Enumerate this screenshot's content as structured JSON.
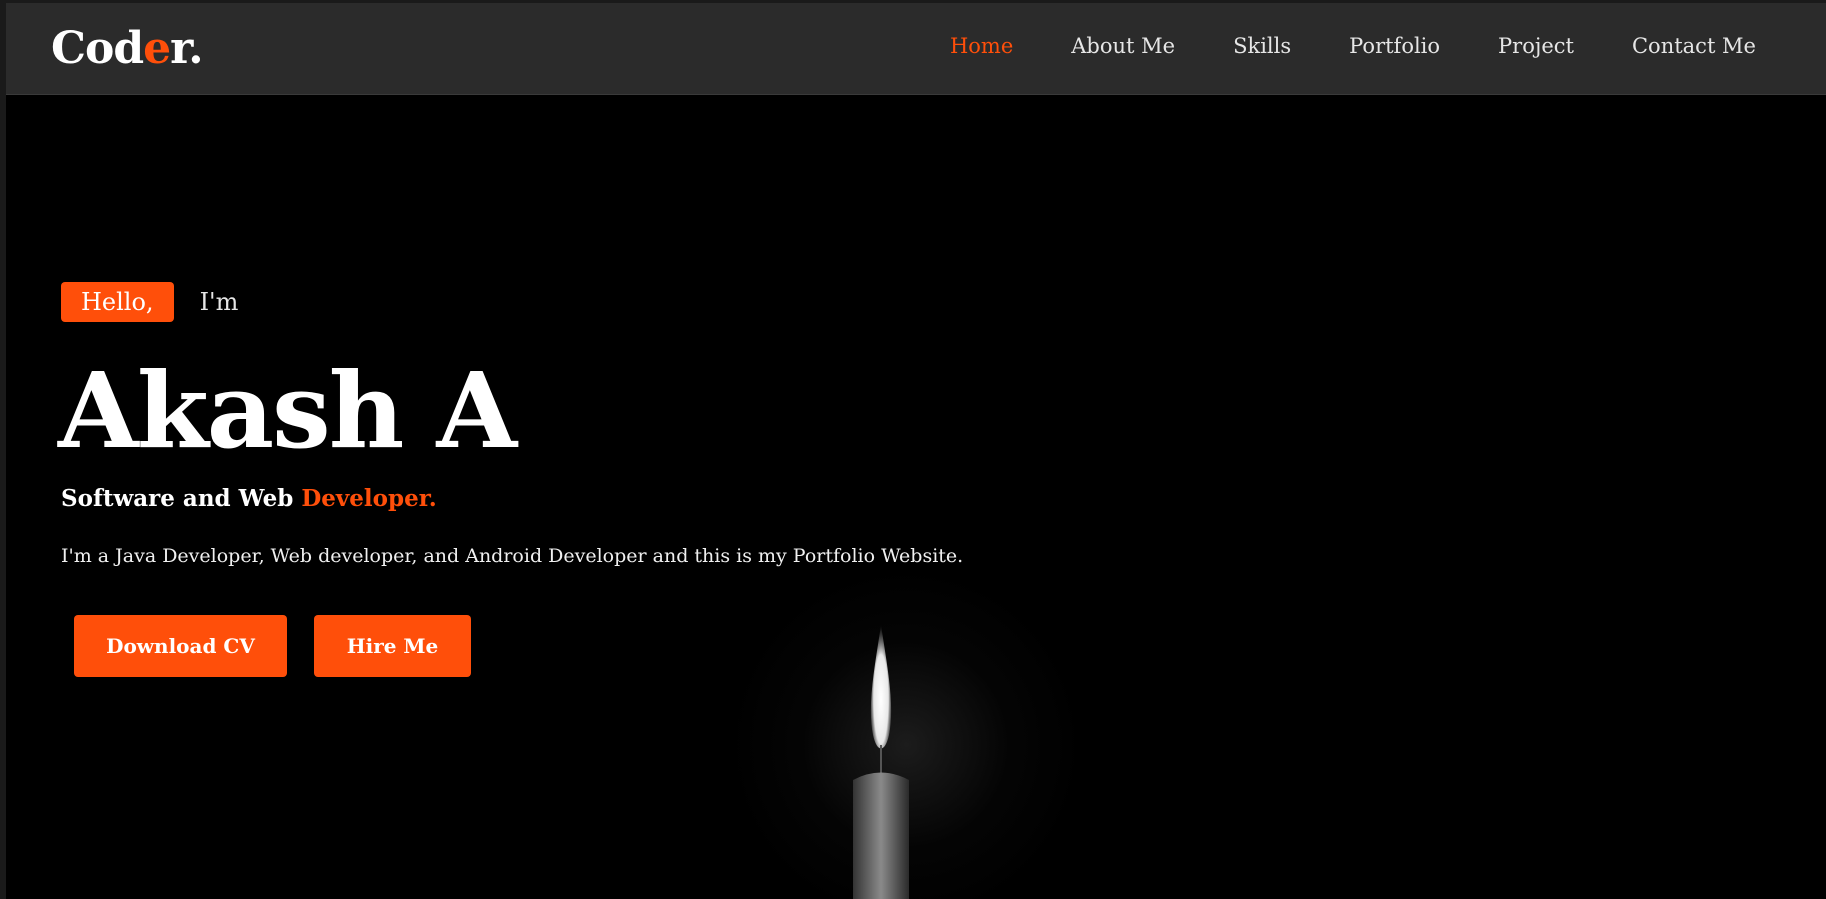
{
  "logo": {
    "text_main": "Cod",
    "text_accent": "e",
    "text_end": "r."
  },
  "nav": {
    "items": [
      {
        "label": "Home",
        "active": true
      },
      {
        "label": "About Me"
      },
      {
        "label": "Skills"
      },
      {
        "label": "Portfolio"
      },
      {
        "label": "Project"
      },
      {
        "label": "Contact Me"
      }
    ]
  },
  "hero": {
    "greeting": "Hello,",
    "im": "I'm",
    "name": "Akash A",
    "role_prefix": "Software and Web ",
    "role_accent": "Developer.",
    "description": "I'm a Java Developer, Web developer, and Android Developer and this is my Portfolio Website.",
    "download_cv_label": "Download CV",
    "hire_me_label": "Hire Me"
  },
  "colors": {
    "accent": "#ff4f0a",
    "navbar": "#2b2b2b",
    "background": "#000000"
  },
  "decor": {
    "image": "candle-flame"
  }
}
